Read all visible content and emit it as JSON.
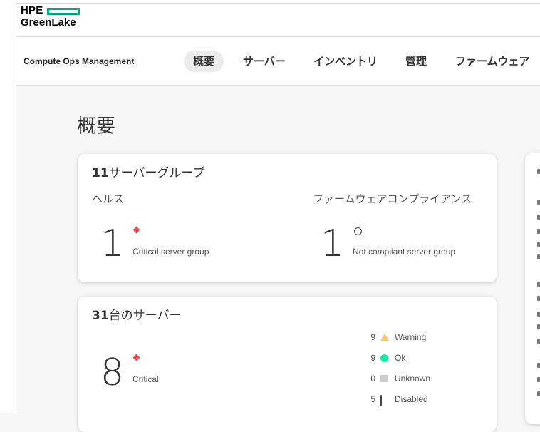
{
  "brand": {
    "logo_line1": "HPE",
    "logo_line2": "GreenLake",
    "accent_color": "#01a982"
  },
  "app": {
    "title": "Compute Ops Management"
  },
  "nav": {
    "tabs": [
      {
        "label": "概要",
        "active": true
      },
      {
        "label": "サーバー",
        "active": false
      },
      {
        "label": "インベントリ",
        "active": false
      },
      {
        "label": "管理",
        "active": false
      },
      {
        "label": "ファームウェア",
        "active": false
      }
    ]
  },
  "page": {
    "title": "概要"
  },
  "group_card": {
    "count": "11",
    "title_suffix": "サーバーグループ",
    "health": {
      "label": "ヘルス",
      "value": "1",
      "desc": "Critical server group",
      "status_icon": "critical-diamond-icon",
      "status_color": "#f04953"
    },
    "firmware": {
      "label": "ファームウェアコンプライアンス",
      "value": "1",
      "desc": "Not compliant server group",
      "icon": "alert-circle-icon",
      "icon_glyph": "!"
    }
  },
  "server_card": {
    "count": "31",
    "title_suffix": "台のサーバー",
    "critical": {
      "value": "8",
      "label": "Critical",
      "status_icon": "critical-diamond-icon",
      "status_color": "#f04953"
    },
    "stats": [
      {
        "count": "9",
        "label": "Warning",
        "icon": "warning-triangle-icon",
        "color": "#ffc95e"
      },
      {
        "count": "9",
        "label": "Ok",
        "icon": "ok-circle-icon",
        "color": "#17eba0"
      },
      {
        "count": "0",
        "label": "Unknown",
        "icon": "unknown-square-icon",
        "color": "#cccccc"
      },
      {
        "count": "5",
        "label": "Disabled",
        "icon": "disabled-box-icon",
        "color": "#444444"
      }
    ]
  }
}
